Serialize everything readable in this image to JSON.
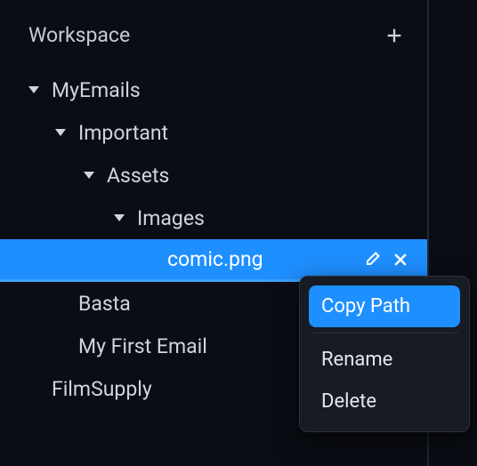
{
  "workspace": {
    "title": "Workspace"
  },
  "tree": {
    "myEmails": "MyEmails",
    "important": "Important",
    "assets": "Assets",
    "images": "Images",
    "comicPng": "comic.png",
    "basta": "Basta",
    "myFirstEmail": "My First Email",
    "filmSupply": "FilmSupply"
  },
  "contextMenu": {
    "copyPath": "Copy Path",
    "rename": "Rename",
    "delete": "Delete"
  }
}
